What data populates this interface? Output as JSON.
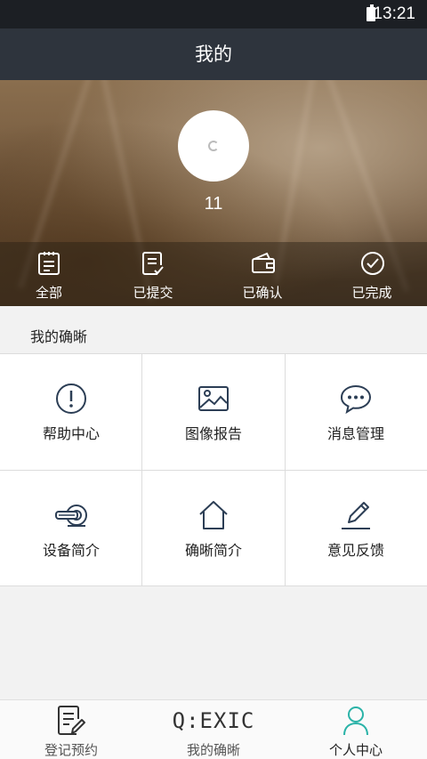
{
  "status_bar": {
    "time": "13:21",
    "battery_icon": "battery-icon"
  },
  "header": {
    "title": "我的"
  },
  "profile": {
    "username": "11",
    "avatar_icon": "avatar-logo-icon"
  },
  "orders": [
    {
      "label": "全部",
      "icon": "document-list-icon"
    },
    {
      "label": "已提交",
      "icon": "document-check-icon"
    },
    {
      "label": "已确认",
      "icon": "wallet-icon"
    },
    {
      "label": "已完成",
      "icon": "check-circle-icon"
    }
  ],
  "section": {
    "title": "我的确晰"
  },
  "grid": [
    {
      "label": "帮助中心",
      "icon": "exclamation-circle-icon"
    },
    {
      "label": "图像报告",
      "icon": "image-icon"
    },
    {
      "label": "消息管理",
      "icon": "chat-bubble-icon"
    },
    {
      "label": "设备简介",
      "icon": "scanner-icon"
    },
    {
      "label": "确晰简介",
      "icon": "home-icon"
    },
    {
      "label": "意见反馈",
      "icon": "pencil-icon"
    }
  ],
  "bottom_nav": [
    {
      "label": "登记预约",
      "icon": "register-icon",
      "active": false
    },
    {
      "label": "我的确晰",
      "logo_text": "Q:EXIC",
      "active": false
    },
    {
      "label": "个人中心",
      "icon": "person-icon",
      "active": true
    }
  ],
  "colors": {
    "accent": "#2bb3a8",
    "title_bar": "#2e343d",
    "status_bar": "#1c1f24",
    "icon_dark": "#2c3e55"
  }
}
